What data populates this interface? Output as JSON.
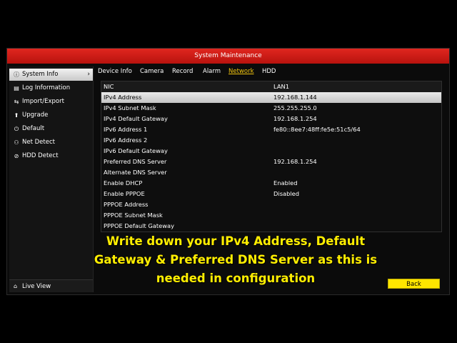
{
  "window": {
    "title": "System Maintenance"
  },
  "sidebar": {
    "items": [
      {
        "label": "System Info",
        "icon": "info-icon",
        "glyph": "ⓘ",
        "active": true
      },
      {
        "label": "Log Information",
        "icon": "log-icon",
        "glyph": "▤"
      },
      {
        "label": "Import/Export",
        "icon": "import-export-icon",
        "glyph": "⇆"
      },
      {
        "label": "Upgrade",
        "icon": "upgrade-icon",
        "glyph": "⬆"
      },
      {
        "label": "Default",
        "icon": "default-icon",
        "glyph": "⏻"
      },
      {
        "label": "Net Detect",
        "icon": "network-icon",
        "glyph": "⚇"
      },
      {
        "label": "HDD Detect",
        "icon": "hdd-icon",
        "glyph": "⊘"
      }
    ],
    "live_view": {
      "label": "Live View",
      "glyph": "⌂"
    },
    "chevron": "›"
  },
  "tabs": [
    {
      "label": "Device Info"
    },
    {
      "label": "Camera"
    },
    {
      "label": "Record"
    },
    {
      "label": "Alarm"
    },
    {
      "label": "Network",
      "active": true
    },
    {
      "label": "HDD"
    }
  ],
  "table": {
    "headers": [
      "NIC",
      "LAN1"
    ],
    "rows": [
      [
        "IPv4 Address",
        "192.168.1.144"
      ],
      [
        "IPv4 Subnet Mask",
        "255.255.255.0"
      ],
      [
        "IPv4 Default Gateway",
        "192.168.1.254"
      ],
      [
        "IPv6 Address 1",
        "fe80::8ee7:48ff:fe5e:51c5/64"
      ],
      [
        "IPv6 Address 2",
        ""
      ],
      [
        "IPv6 Default Gateway",
        ""
      ],
      [
        "Preferred DNS Server",
        "192.168.1.254"
      ],
      [
        "Alternate DNS Server",
        ""
      ],
      [
        "Enable DHCP",
        "Enabled"
      ],
      [
        "Enable PPPOE",
        "Disabled"
      ],
      [
        "PPPOE Address",
        ""
      ],
      [
        "PPPOE Subnet Mask",
        ""
      ],
      [
        "PPPOE Default Gateway",
        ""
      ]
    ]
  },
  "caption": {
    "line1": "Write down your IPv4 Address, Default",
    "line2": "Gateway & Preferred DNS Server as this is",
    "line3": "needed in configuration"
  },
  "buttons": {
    "back": "Back"
  },
  "colors": {
    "titlebar": "#d41c16",
    "active_tab": "#f1c40f",
    "caption": "#ffee00",
    "back_button": "#ffe600"
  }
}
